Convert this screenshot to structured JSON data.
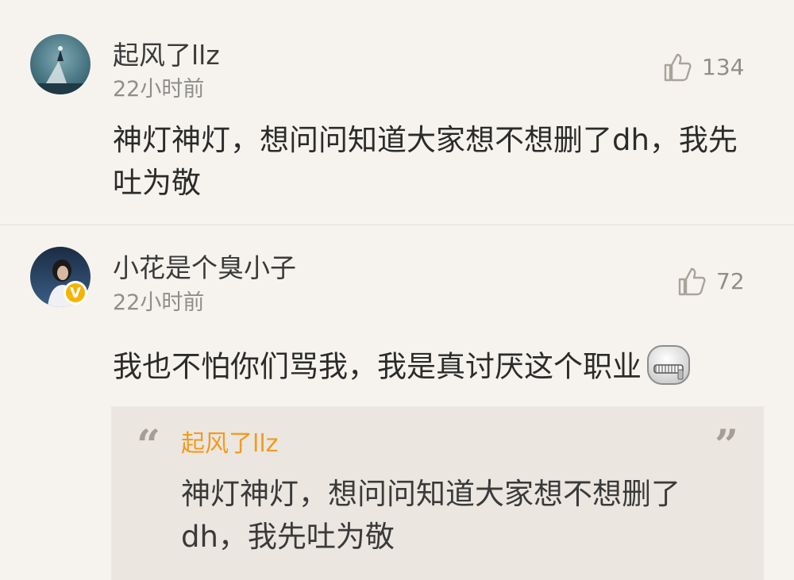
{
  "comments": [
    {
      "username": "起风了llz",
      "time": "22小时前",
      "likes": "134",
      "text": "神灯神灯，想问问知道大家想不想删了dh，我先吐为敬"
    },
    {
      "username": "小花是个臭小子",
      "time": "22小时前",
      "likes": "72",
      "verified_badge": "V",
      "text": "我也不怕你们骂我，我是真讨厌这个职业",
      "emoji": "zipper-mouth-emoji",
      "quote": {
        "open_mark": "“",
        "close_mark": "”",
        "username": "起风了llz",
        "text": "神灯神灯，想问问知道大家想不想删了dh，我先吐为敬"
      }
    }
  ],
  "colors": {
    "background": "#f6f3ee",
    "quote_background": "#ebe6e0",
    "quote_username": "#f39a1d",
    "verified_badge": "#f4b400",
    "muted_text": "#8e8e8e"
  },
  "icons": {
    "like": "thumbs-up-icon"
  }
}
